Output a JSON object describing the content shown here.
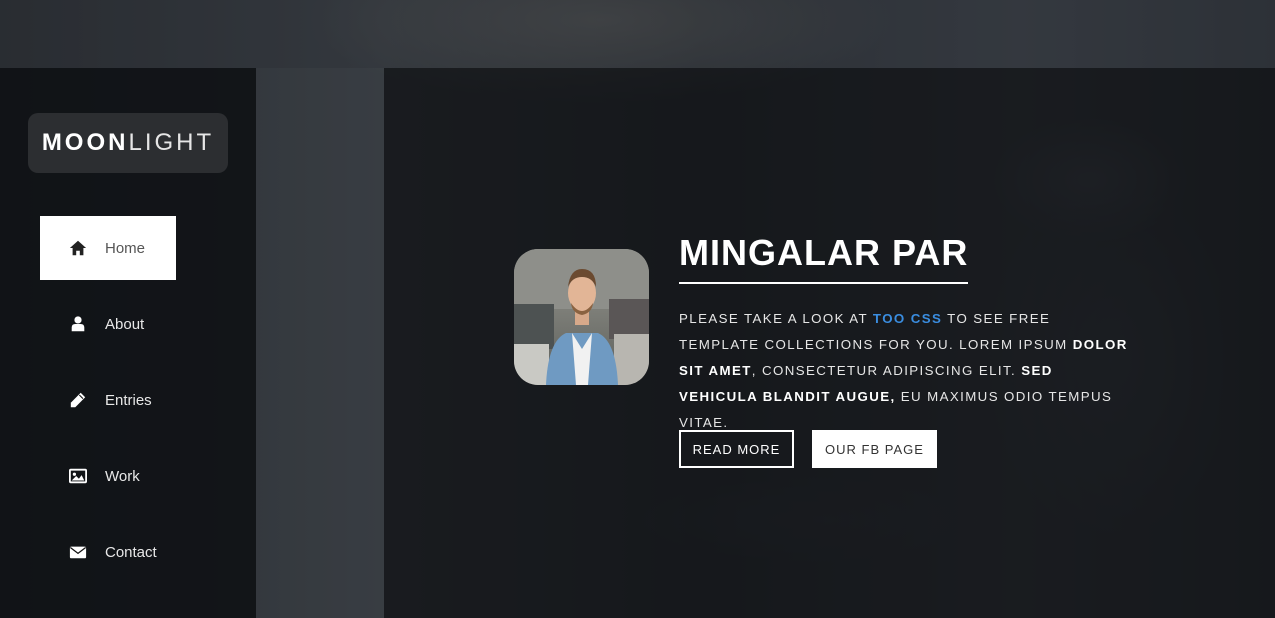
{
  "brand": {
    "bold": "MOON",
    "light": "LIGHT"
  },
  "nav": [
    {
      "label": "Home",
      "icon": "home-icon",
      "active": true
    },
    {
      "label": "About",
      "icon": "user-icon",
      "active": false
    },
    {
      "label": "Entries",
      "icon": "pencil-icon",
      "active": false
    },
    {
      "label": "Work",
      "icon": "image-icon",
      "active": false
    },
    {
      "label": "Contact",
      "icon": "envelope-icon",
      "active": false
    }
  ],
  "hero": {
    "title": "MINGALAR PAR",
    "text": {
      "p1": "PLEASE TAKE A LOOK AT ",
      "link": "TOO CSS",
      "p2": " TO SEE FREE TEMPLATE COLLECTIONS FOR YOU. LOREM IPSUM ",
      "b1": "DOLOR SIT AMET",
      "p3": ", CONSECTETUR ADIPISCING ELIT. ",
      "b2": "SED VEHICULA BLANDIT AUGUE,",
      "p4": " EU MAXIMUS ODIO TEMPUS VITAE."
    },
    "buttons": {
      "read_more": "READ MORE",
      "fb_page": "OUR FB PAGE"
    }
  },
  "colors": {
    "link": "#3a8de0",
    "active_nav_bg": "#ffffff",
    "logo_bg": "#2c2e31"
  }
}
